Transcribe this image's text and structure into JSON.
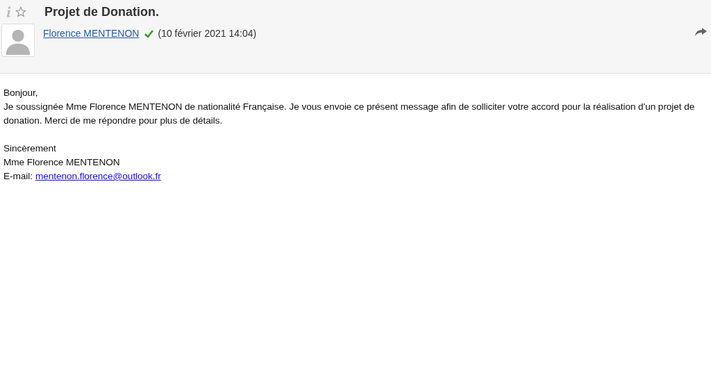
{
  "message": {
    "subject": "Projet de Donation.",
    "starred": false,
    "sender": "Florence MENTENON",
    "verified": true,
    "date": "(10 février 2021 14:04)"
  },
  "body": {
    "greeting": "Bonjour,",
    "paragraph": "Je soussignée Mme Florence MENTENON de nationalité Française. Je vous envoie ce présent message afin de solliciter votre accord pour la réalisation d'un projet de donation. Merci de me répondre pour plus de détails.",
    "closing": "Sincèrement",
    "signature": "Mme Florence MENTENON",
    "email_label": "E-mail:",
    "email": "mentenon.florence@outlook.fr"
  }
}
